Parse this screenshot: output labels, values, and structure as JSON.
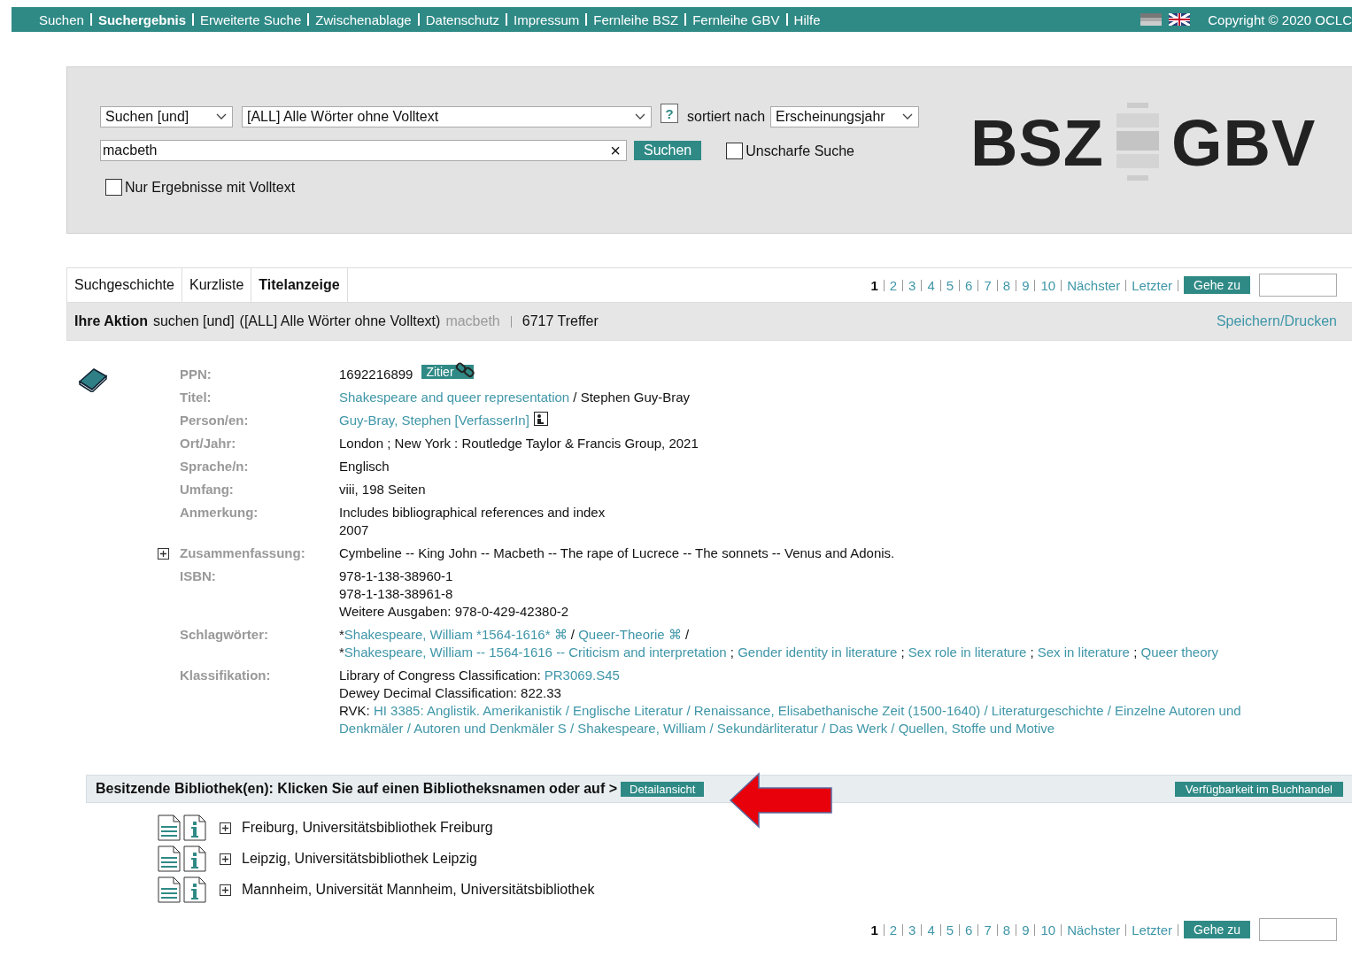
{
  "top_nav": {
    "items": [
      {
        "label": "Suchen",
        "selected": false
      },
      {
        "label": "Suchergebnis",
        "selected": true
      },
      {
        "label": "Erweiterte Suche",
        "selected": false
      },
      {
        "label": "Zwischenablage",
        "selected": false
      },
      {
        "label": "Datenschutz",
        "selected": false
      },
      {
        "label": "Impressum",
        "selected": false
      },
      {
        "label": "Fernleihe BSZ",
        "selected": false
      },
      {
        "label": "Fernleihe GBV",
        "selected": false
      },
      {
        "label": "Hilfe",
        "selected": false
      }
    ],
    "copyright": "Copyright © 2020 OCLC"
  },
  "search": {
    "operator": "Suchen [und]",
    "field": "[ALL] Alle Wörter ohne Volltext",
    "help": "?",
    "sort_label": "sortiert nach",
    "sort": "Erscheinungsjahr",
    "query": "macbeth",
    "clear": "×",
    "submit": "Suchen",
    "fuzzy": {
      "label": "Unscharfe Suche",
      "checked": false
    },
    "fulltext_only": {
      "label": "Nur Ergebnisse mit Volltext",
      "checked": false
    }
  },
  "logo": {
    "left": "BSZ",
    "right": "GBV"
  },
  "tabs": [
    {
      "label": "Suchgeschichte",
      "selected": false
    },
    {
      "label": "Kurzliste",
      "selected": false
    },
    {
      "label": "Titelanzeige",
      "selected": true
    }
  ],
  "pagination_top": {
    "pages": [
      {
        "label": "1",
        "selected": true
      },
      {
        "label": "2",
        "selected": false
      },
      {
        "label": "3",
        "selected": false
      },
      {
        "label": "4",
        "selected": false
      },
      {
        "label": "5",
        "selected": false
      },
      {
        "label": "6",
        "selected": false
      },
      {
        "label": "7",
        "selected": false
      },
      {
        "label": "8",
        "selected": false
      },
      {
        "label": "9",
        "selected": false
      },
      {
        "label": "10",
        "selected": false
      }
    ],
    "next": "Nächster",
    "last": "Letzter",
    "goto": "Gehe zu"
  },
  "action_bar": {
    "label": "Ihre Aktion",
    "query": "suchen [und]",
    "field": "([ALL] Alle Wörter ohne Volltext)",
    "term": "macbeth",
    "hits": "6717 Treffer",
    "save": "Speichern/Drucken"
  },
  "record": {
    "fields": [
      {
        "label": "PPN:",
        "expandable": false,
        "lines": [
          [
            {
              "kind": "text",
              "text": "1692216899"
            },
            {
              "kind": "cite",
              "text": "Zitier"
            }
          ]
        ]
      },
      {
        "label": "Titel:",
        "expandable": false,
        "lines": [
          [
            {
              "kind": "link",
              "text": "Shakespeare and queer representation"
            },
            {
              "kind": "text",
              "text": " / Stephen Guy-Bray"
            }
          ]
        ]
      },
      {
        "label": "Person/en:",
        "expandable": false,
        "lines": [
          [
            {
              "kind": "link",
              "text": "Guy-Bray, Stephen [VerfasserIn]"
            },
            {
              "kind": "person"
            }
          ]
        ]
      },
      {
        "label": "Ort/Jahr:",
        "expandable": false,
        "lines": [
          [
            {
              "kind": "text",
              "text": "London ; New York : Routledge Taylor & Francis Group, 2021"
            }
          ]
        ]
      },
      {
        "label": "Sprache/n:",
        "expandable": false,
        "lines": [
          [
            {
              "kind": "text",
              "text": "Englisch"
            }
          ]
        ]
      },
      {
        "label": "Umfang:",
        "expandable": false,
        "lines": [
          [
            {
              "kind": "text",
              "text": "viii, 198 Seiten"
            }
          ]
        ]
      },
      {
        "label": "Anmerkung:",
        "expandable": false,
        "lines": [
          [
            {
              "kind": "text",
              "text": "Includes bibliographical references and index"
            }
          ],
          [
            {
              "kind": "text",
              "text": "2007"
            }
          ]
        ]
      },
      {
        "label": "Zusammenfassung:",
        "expandable": true,
        "lines": [
          [
            {
              "kind": "text",
              "text": "Cymbeline -- King John -- Macbeth -- The rape of Lucrece -- The sonnets -- Venus and Adonis."
            }
          ]
        ]
      },
      {
        "label": "ISBN:",
        "expandable": false,
        "lines": [
          [
            {
              "kind": "text",
              "text": "978-1-138-38960-1"
            }
          ],
          [
            {
              "kind": "text",
              "text": "978-1-138-38961-8"
            }
          ],
          [
            {
              "kind": "text",
              "text": "Weitere Ausgaben: 978-0-429-42380-2"
            }
          ]
        ]
      },
      {
        "label": "Schlagwörter:",
        "expandable": false,
        "lines": [
          [
            {
              "kind": "text",
              "text": "*"
            },
            {
              "kind": "link",
              "text": "Shakespeare, William *1564-1616*"
            },
            {
              "kind": "symbol",
              "text": " ⌘"
            },
            {
              "kind": "text",
              "text": " / "
            },
            {
              "kind": "link",
              "text": "Queer-Theorie"
            },
            {
              "kind": "symbol",
              "text": " ⌘"
            },
            {
              "kind": "text",
              "text": " /"
            }
          ],
          [
            {
              "kind": "text",
              "text": "*"
            },
            {
              "kind": "link",
              "text": "Shakespeare, William -- 1564-1616 -- Criticism and interpretation"
            },
            {
              "kind": "text",
              "text": " ; "
            },
            {
              "kind": "link",
              "text": "Gender identity in literature"
            },
            {
              "kind": "text",
              "text": " ; "
            },
            {
              "kind": "link",
              "text": "Sex role in literature"
            },
            {
              "kind": "text",
              "text": " ; "
            },
            {
              "kind": "link",
              "text": "Sex in literature"
            },
            {
              "kind": "text",
              "text": " ; "
            },
            {
              "kind": "link",
              "text": "Queer theory"
            }
          ]
        ]
      },
      {
        "label": "Klassifikation:",
        "expandable": false,
        "lines": [
          [
            {
              "kind": "text",
              "text": "Library of Congress Classification: "
            },
            {
              "kind": "link",
              "text": "PR3069.S45"
            }
          ],
          [
            {
              "kind": "text",
              "text": "Dewey Decimal Classification: 822.33"
            }
          ],
          [
            {
              "kind": "text",
              "text": "RVK: "
            },
            {
              "kind": "link",
              "text": "HI 3385: Anglistik. Amerikanistik / Englische Literatur / Renaissance, Elisabethanische Zeit (1500-1640) / Literaturgeschichte / Einzelne Autoren und"
            }
          ],
          [
            {
              "kind": "link",
              "text": "Denkmäler / Autoren und Denkmäler S / Shakespeare, William / Sekundärliteratur / Das Werk / Quellen, Stoffe und Motive"
            }
          ]
        ]
      }
    ]
  },
  "holdings": {
    "heading": "Besitzende Bibliothek(en): Klicken Sie auf einen Bibliotheksnamen oder auf >",
    "detail_button": "Detailansicht",
    "availability_button": "Verfügbarkeit im Buchhandel",
    "libraries": [
      "Freiburg, Universitätsbibliothek Freiburg",
      "Leipzig, Universitätsbibliothek Leipzig",
      "Mannheim, Universität Mannheim, Universitätsbibliothek"
    ]
  },
  "pagination_bottom": {
    "pages": [
      {
        "label": "1",
        "selected": true
      },
      {
        "label": "2",
        "selected": false
      },
      {
        "label": "3",
        "selected": false
      },
      {
        "label": "4",
        "selected": false
      },
      {
        "label": "5",
        "selected": false
      },
      {
        "label": "6",
        "selected": false
      },
      {
        "label": "7",
        "selected": false
      },
      {
        "label": "8",
        "selected": false
      },
      {
        "label": "9",
        "selected": false
      },
      {
        "label": "10",
        "selected": false
      }
    ],
    "next": "Nächster",
    "last": "Letzter",
    "goto": "Gehe zu"
  }
}
